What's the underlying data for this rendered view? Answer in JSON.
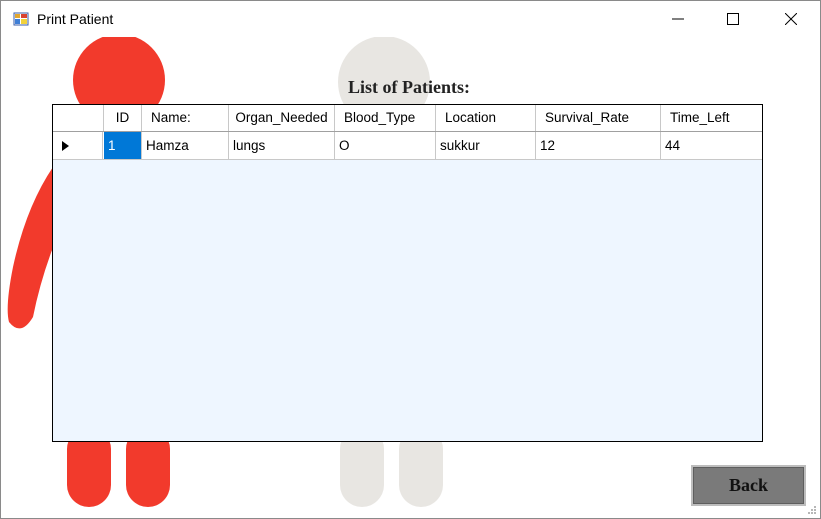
{
  "window": {
    "title": "Print Patient",
    "controls": [
      "minimize",
      "maximize",
      "close"
    ]
  },
  "heading": "List of Patients:",
  "grid": {
    "columns": [
      "ID",
      "Name:",
      "Organ_Needed",
      "Blood_Type",
      "Location",
      "Survival_Rate",
      "Time_Left"
    ],
    "rows": [
      {
        "ID": "1",
        "Name": "Hamza",
        "Organ_Needed": "lungs",
        "Blood_Type": "O",
        "Location": "sukkur",
        "Survival_Rate": "12",
        "Time_Left": "44"
      }
    ],
    "selected_cell": "ID",
    "row_header_icon": "triangle-right-icon"
  },
  "back_button": {
    "label": "Back"
  },
  "colors": {
    "figure_red": "#f23a2c",
    "figure_grey": "#e8e6e2",
    "selection_blue": "#0078d7",
    "grid_background": "#eef6ff",
    "button_grey": "#7a7a7a"
  }
}
